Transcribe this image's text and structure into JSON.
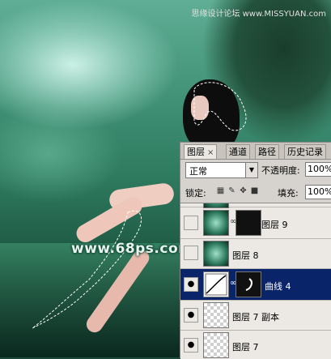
{
  "watermarks": {
    "top": "思缘设计论坛 www.MISSYUAN.com",
    "middle": "www.68ps.com"
  },
  "panel": {
    "tabs": [
      {
        "label": "图层",
        "close": "×",
        "active": true
      },
      {
        "label": "通道",
        "active": false
      },
      {
        "label": "路径",
        "active": false
      },
      {
        "label": "历史记录",
        "active": false
      }
    ],
    "blend_mode": "正常",
    "opacity_label": "不透明度:",
    "opacity_value": "100%",
    "lock_label": "锁定:",
    "fill_label": "填充:",
    "fill_value": "100%",
    "layers": [
      {
        "name": "图层 9",
        "visible": false,
        "thumb": "photo",
        "mask": "dark",
        "selected": false
      },
      {
        "name": "图层 8",
        "visible": false,
        "thumb": "photo",
        "mask": null,
        "selected": false
      },
      {
        "name": "曲线 4",
        "visible": true,
        "thumb": "curve",
        "mask": "dark",
        "selected": true
      },
      {
        "name": "图层 7 副本",
        "visible": true,
        "thumb": "checker",
        "mask": null,
        "selected": false
      },
      {
        "name": "图层 7",
        "visible": true,
        "thumb": "checker",
        "mask": null,
        "selected": false
      }
    ]
  }
}
